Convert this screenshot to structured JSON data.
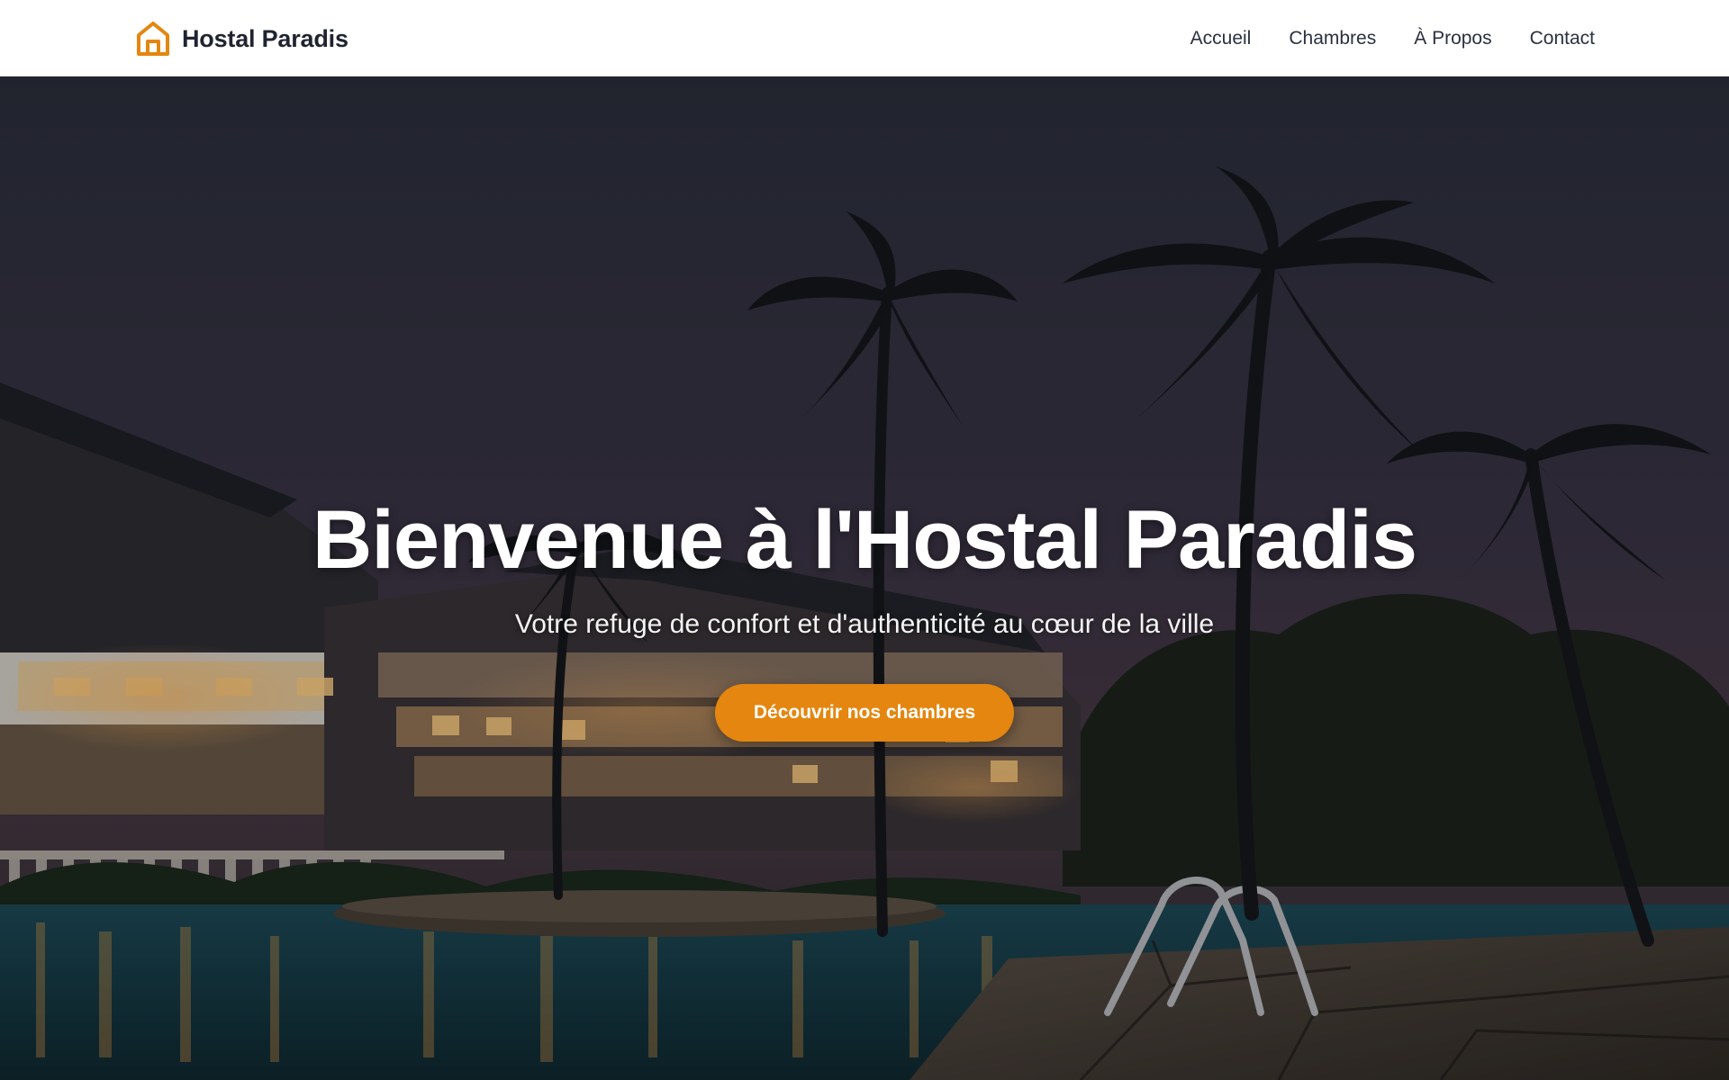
{
  "brand": {
    "name": "Hostal Paradis",
    "icon": "home-icon",
    "accent_color": "#e4860f"
  },
  "nav": {
    "items": [
      {
        "label": "Accueil"
      },
      {
        "label": "Chambres"
      },
      {
        "label": "À Propos"
      },
      {
        "label": "Contact"
      }
    ]
  },
  "hero": {
    "title": "Bienvenue à l'Hostal Paradis",
    "subtitle": "Votre refuge de confort et d'authenticité au cœur de la ville",
    "cta_label": "Découvrir nos chambres",
    "cta_color": "#e4860f",
    "background": "night-tropical-resort-with-palm-trees-and-pool"
  }
}
